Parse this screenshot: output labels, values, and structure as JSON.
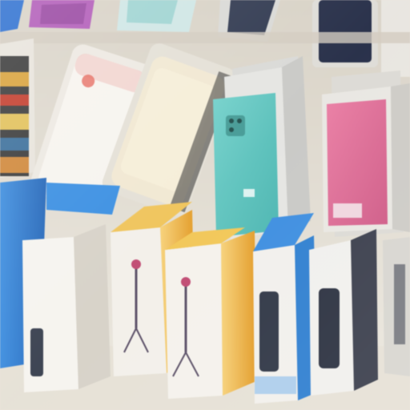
{
  "scene": {
    "description_label": "",
    "colors": {
      "wall": "#e3ddd2",
      "shelf_shadow": "#cfc8bb",
      "pink_case": "#e06a93",
      "teal_case": "#5fc6c0",
      "white_case": "#f4f1ec",
      "cream_case": "#efe6cf",
      "blue_box": "#2f7fd0",
      "yellow_box": "#f1b53c",
      "navy_case": "#2c3552",
      "purple_case": "#a04fa8"
    },
    "top_row": [
      {
        "name": "blue-case-top-left",
        "color": "#2c6fd0"
      },
      {
        "name": "purple-case-top",
        "color": "#a04fa8"
      },
      {
        "name": "mint-case-top",
        "color": "#a9d8d6"
      },
      {
        "name": "dark-case-top",
        "color": "#2c3552"
      },
      {
        "name": "navy-case-top-right",
        "color": "#252d47"
      }
    ],
    "middle_row": [
      {
        "name": "striped-case-left",
        "color": "#d9a23b"
      },
      {
        "name": "white-case",
        "color": "#f4f1ec"
      },
      {
        "name": "cream-case",
        "color": "#efe6cf"
      },
      {
        "name": "teal-case",
        "color": "#5fc6c0"
      },
      {
        "name": "pink-case",
        "color": "#e06a93"
      }
    ],
    "bottom_row": [
      {
        "name": "blue-box-left",
        "color": "#2f7fd0"
      },
      {
        "name": "white-box-tripod",
        "color": "#f6f4ef"
      },
      {
        "name": "yellow-box-tripod-1",
        "color": "#f1b53c"
      },
      {
        "name": "yellow-box-tripod-2",
        "color": "#f1b53c"
      },
      {
        "name": "blue-white-box-1",
        "color": "#2f7fd0"
      },
      {
        "name": "white-box-dark",
        "color": "#f2f2ef"
      },
      {
        "name": "grey-box-right",
        "color": "#d8d6d0"
      }
    ]
  }
}
